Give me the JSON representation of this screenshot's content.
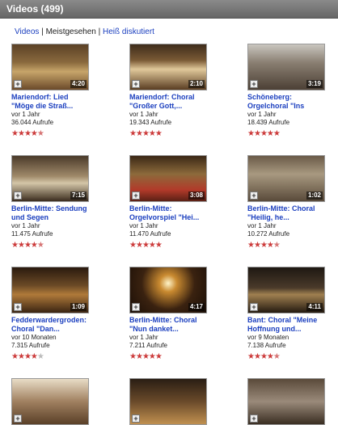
{
  "header": {
    "title": "Videos (499)"
  },
  "subnav": {
    "items": [
      {
        "label": "Videos",
        "current": false
      },
      {
        "label": "Meistgesehen",
        "current": true
      },
      {
        "label": "Heiß diskutiert",
        "current": false
      }
    ],
    "separator": "|"
  },
  "videos": [
    {
      "title": "Mariendorf: Lied \"Möge die Straß...",
      "age": "vor 1 Jahr",
      "views": "36.044 Aufrufe",
      "duration": "4:20",
      "rating": 4.5,
      "thumb": "church-interior"
    },
    {
      "title": "Mariendorf: Choral \"Großer Gott,...",
      "age": "vor 1 Jahr",
      "views": "19.343 Aufrufe",
      "duration": "2:10",
      "rating": 5,
      "thumb": "church-altar"
    },
    {
      "title": "Schöneberg: Orgelchoral \"Ins",
      "age": "vor 1 Jahr",
      "views": "18.439 Aufrufe",
      "duration": "3:19",
      "rating": 5,
      "thumb": "organ"
    },
    {
      "title": "Berlin-Mitte: Sendung und Segen",
      "age": "vor 1 Jahr",
      "views": "11.475 Aufrufe",
      "duration": "7:15",
      "rating": 4.5,
      "thumb": "church-nave"
    },
    {
      "title": "Berlin-Mitte: Orgelvorspiel \"Hei...",
      "age": "vor 1 Jahr",
      "views": "11.470 Aufrufe",
      "duration": "3:08",
      "rating": 5,
      "thumb": "church-altar-red"
    },
    {
      "title": "Berlin-Mitte: Choral \"Heilig, he...",
      "age": "vor 1 Jahr",
      "views": "10.272 Aufrufe",
      "duration": "1:02",
      "rating": 4.5,
      "thumb": "organ-pipes"
    },
    {
      "title": "Fedderwardergroden: Choral \"Dan...",
      "age": "vor 10 Monaten",
      "views": "7.315 Aufrufe",
      "duration": "1:09",
      "rating": 4,
      "thumb": "wooden-interior"
    },
    {
      "title": "Berlin-Mitte: Choral \"Nun danket...",
      "age": "vor 1 Jahr",
      "views": "7.211 Aufrufe",
      "duration": "4:17",
      "rating": 5,
      "thumb": "chandelier"
    },
    {
      "title": "Bant: Choral \"Meine Hoffnung und...",
      "age": "vor 9 Monaten",
      "views": "7.138 Aufrufe",
      "duration": "4:11",
      "rating": 4.5,
      "thumb": "dark-church"
    },
    {
      "title": "",
      "age": "",
      "views": "",
      "duration": "",
      "rating": null,
      "thumb": "church-vault"
    },
    {
      "title": "",
      "age": "",
      "views": "",
      "duration": "",
      "rating": null,
      "thumb": "church-dark-nave"
    },
    {
      "title": "",
      "age": "",
      "views": "",
      "duration": "",
      "rating": null,
      "thumb": "church-arch"
    }
  ],
  "colors": {
    "link": "#1b3fbf",
    "star": "#cc3b3b",
    "header_bg": "#707070"
  }
}
